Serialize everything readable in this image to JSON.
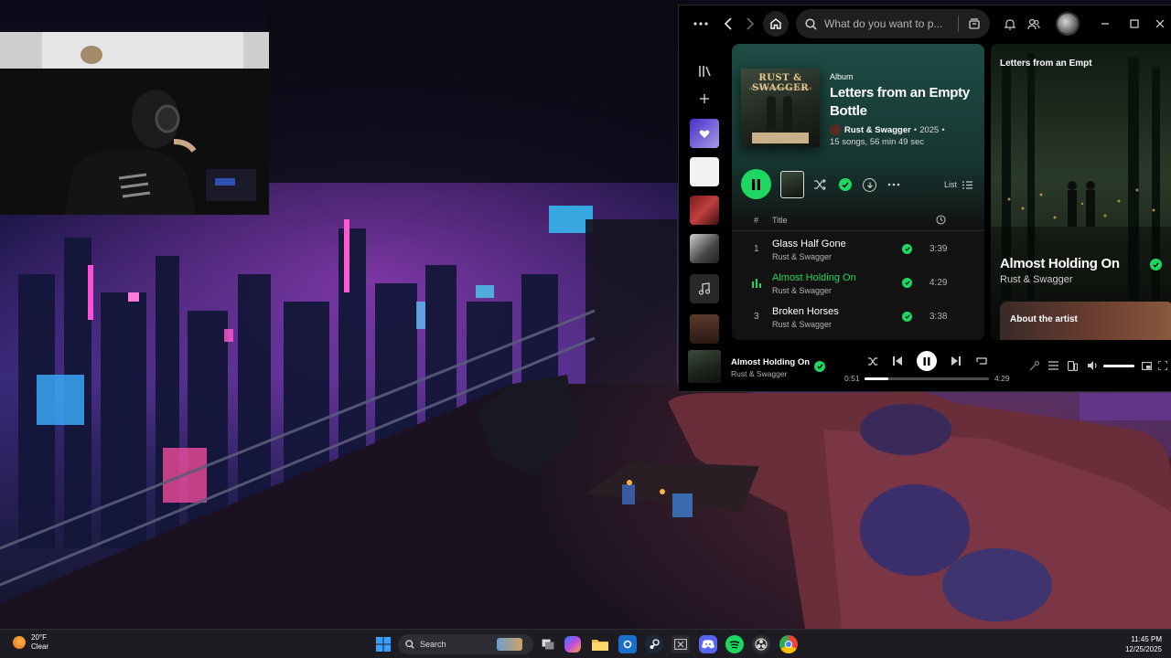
{
  "spotify": {
    "search_placeholder": "What do you want to p...",
    "album": {
      "type_label": "Album",
      "title": "Letters from an Empty Bottle",
      "artist": "Rust & Swagger",
      "year": "2025",
      "separator": "•",
      "stats": "15 songs, 56 min 49 sec",
      "cover_text_main": "RUST & SWAGGER",
      "cover_text_sub": "LETTERS FROM AN EMPTY BOTTLE"
    },
    "view_mode_label": "List",
    "track_header": {
      "number": "#",
      "title": "Title"
    },
    "tracks": [
      {
        "number": "1",
        "title": "Glass Half Gone",
        "artist": "Rust & Swagger",
        "duration": "3:39",
        "playing": false
      },
      {
        "number": "",
        "title": "Almost Holding On",
        "artist": "Rust & Swagger",
        "duration": "4:29",
        "playing": true
      },
      {
        "number": "3",
        "title": "Broken Horses",
        "artist": "Rust & Swagger",
        "duration": "3:38",
        "playing": false
      }
    ],
    "now_playing_panel": {
      "header": "Letters from an Empt",
      "song": "Almost Holding On",
      "artist": "Rust & Swagger",
      "about_label": "About the artist"
    },
    "player": {
      "title": "Almost Holding On",
      "artist": "Rust & Swagger",
      "elapsed": "0:51",
      "total": "4:29",
      "progress_fraction": 0.19,
      "volume_fraction": 1.0
    }
  },
  "taskbar": {
    "weather_temp": "20°F",
    "weather_desc": "Clear",
    "search_placeholder": "Search",
    "time": "11:45 PM",
    "date": "12/25/2025"
  },
  "colors": {
    "spotify_green": "#1ed760",
    "album_header": "#1f4b45",
    "taskbar": "#1c1c22"
  }
}
